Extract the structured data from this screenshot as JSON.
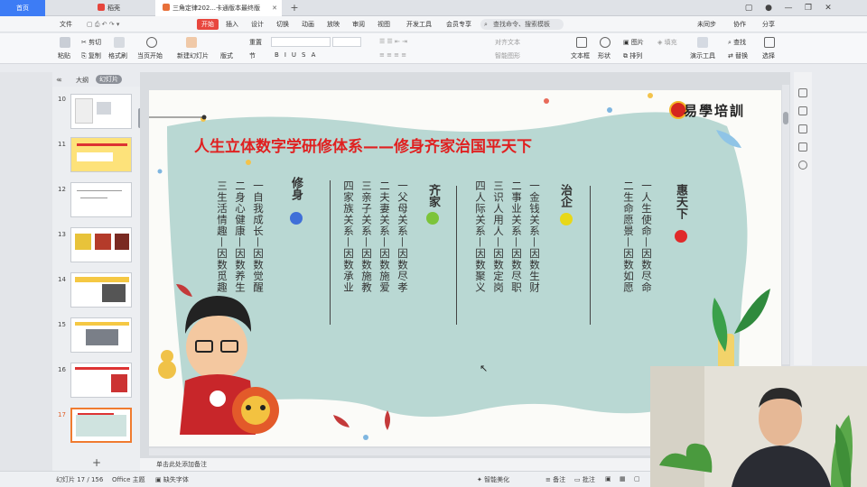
{
  "tabs": {
    "home": "首页",
    "straw": "稻壳",
    "doc": "三角定律202...卡通版本最终版"
  },
  "menu": {
    "file": "文件",
    "items": [
      "开始",
      "插入",
      "设计",
      "切换",
      "动画",
      "放映",
      "审阅",
      "视图",
      "开发工具",
      "会员专享"
    ],
    "search": "查找命令、搜索模板",
    "right": [
      "未同步",
      "协作",
      "分享"
    ]
  },
  "ribbon": {
    "cut": "剪切",
    "copy": "复制",
    "paste": "粘贴",
    "format_painter": "格式刷",
    "play_from_current": "当页开始",
    "new_slide": "新建幻灯片",
    "layout": "版式",
    "section": "节",
    "reset": "重置",
    "align_text": "对齐文本",
    "smart_graphic": "智能图形",
    "textbox": "文本框",
    "shapes": "形状",
    "arrange": "排列",
    "picture": "图片",
    "fill": "填充",
    "find": "查找",
    "replace": "替换",
    "select": "选择",
    "presenter_tools": "演示工具",
    "font_buttons": [
      "B",
      "I",
      "U",
      "S",
      "A"
    ]
  },
  "panel": {
    "outline_tab": "大纲",
    "slides_tab": "幻灯片"
  },
  "thumbnails": [
    "10",
    "11",
    "12",
    "13",
    "14",
    "15",
    "16",
    "17"
  ],
  "slide": {
    "title": "人生立体数字学研修体系——修身齐家治国平天下",
    "brand": "易學培訓",
    "groups": [
      {
        "head": "修身",
        "dot": "#3f6fd8",
        "items": [
          "一自我成长—因数觉醒",
          "二身心健康—因数养生",
          "三生活情趣—因数觅趣"
        ]
      },
      {
        "head": "齐家",
        "dot": "#7cc43a",
        "items": [
          "一父母关系—因数尽孝",
          "二夫妻关系—因数施爱",
          "三亲子关系—因数施教",
          "四家族关系—因数承业"
        ]
      },
      {
        "head": "治企",
        "dot": "#e8d818",
        "items": [
          "一金钱关系—因数生财",
          "二事业关系—因数尽职",
          "三识人用人—因数定岗",
          "四人际关系—因数聚义"
        ]
      },
      {
        "head": "惠天下",
        "dot": "#e02a2a",
        "items": [
          "一人生使命—因数尽命",
          "二生命愿景—因数如愿"
        ]
      }
    ]
  },
  "notes_placeholder": "单击此处添加备注",
  "status": {
    "slide_index": "幻灯片 17 / 156",
    "theme": "Office 主题",
    "missing_font": "缺失字体",
    "smart_beautify": "智能美化",
    "notes": "备注",
    "comments": "批注"
  },
  "colors": {
    "accent": "#e8473e",
    "title_red": "#e02020",
    "blob": "#b9d8d3",
    "home_tab": "#3d7cf5"
  }
}
